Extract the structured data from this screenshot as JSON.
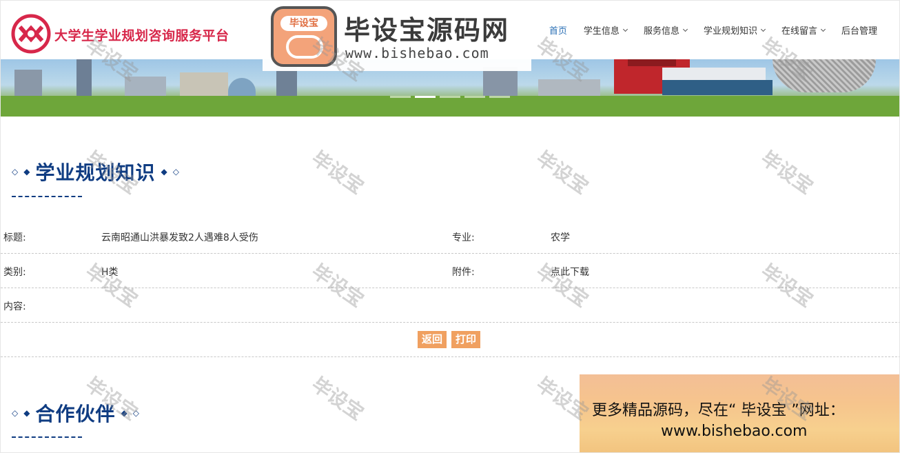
{
  "header": {
    "site_title": "大学生学业规划咨询服务平台",
    "nav": [
      {
        "label": "首页",
        "has_dropdown": false,
        "active": true
      },
      {
        "label": "学生信息",
        "has_dropdown": true,
        "active": false
      },
      {
        "label": "服务信息",
        "has_dropdown": true,
        "active": false
      },
      {
        "label": "学业规划知识",
        "has_dropdown": true,
        "active": false
      },
      {
        "label": "在线留言",
        "has_dropdown": true,
        "active": false
      },
      {
        "label": "后台管理",
        "has_dropdown": false,
        "active": false
      }
    ]
  },
  "brand_watermark": {
    "badge_text": "毕设宝",
    "name": "毕设宝源码网",
    "url": "www.bishebao.com"
  },
  "banner": {
    "slides": 5,
    "active_slide": 2
  },
  "section_knowledge": {
    "title": "学业规划知识"
  },
  "detail": {
    "title_label": "标题:",
    "title_value": "云南昭通山洪暴发致2人遇难8人受伤",
    "major_label": "专业:",
    "major_value": "农学",
    "category_label": "类别:",
    "category_value": "H类",
    "attachment_label": "附件:",
    "attachment_value": "点此下载",
    "content_label": "内容:",
    "content_value": ""
  },
  "buttons": {
    "back_label": "返回",
    "print_label": "打印"
  },
  "section_partners": {
    "title": "合作伙伴"
  },
  "promo": {
    "line1": "更多精品源码，尽在“ 毕设宝 ”网址：",
    "line2": "www.bishebao.com"
  },
  "watermark_text": "毕设宝",
  "colors": {
    "heading_blue": "#0f3c82",
    "title_red": "#d7274a",
    "button_orange": "#f0a060"
  }
}
